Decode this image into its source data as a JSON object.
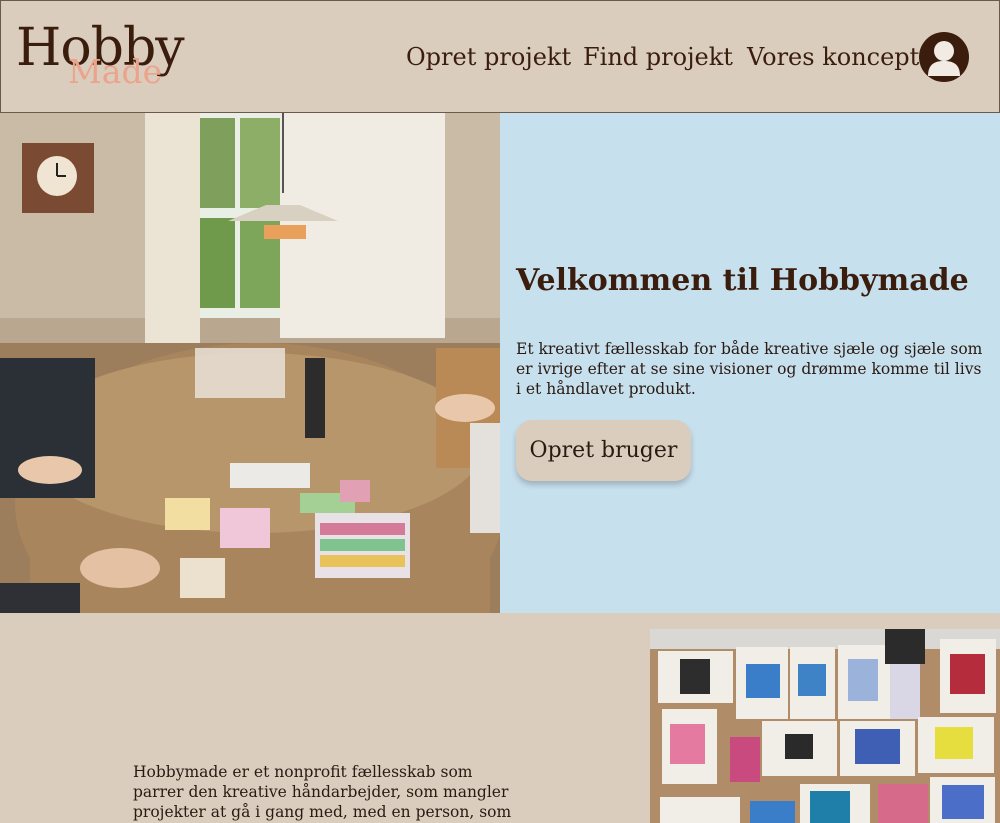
{
  "header": {
    "logo": {
      "line1": "Hobby",
      "line2": "Made"
    },
    "nav": [
      {
        "label": "Opret projekt"
      },
      {
        "label": "Find projekt"
      },
      {
        "label": "Vores koncept"
      }
    ],
    "avatar_icon": "user-avatar-icon"
  },
  "hero": {
    "title": "Velkommen til Hobbymade",
    "text": "Et kreativt fællesskab for både kreative sjæle og sjæle som er ivrige efter at se sine visioner og drømme komme til livs i et håndlavet produkt.",
    "button_label": "Opret bruger",
    "image_icon": "workshop-table-photo"
  },
  "about": {
    "text": "Hobbymade er et nonprofit fællesskab som parrer den kreative håndarbejder, som mangler projekter at gå i gang med, med en person, som har ønsker,"
  },
  "art_image_icon": "art-prints-photo",
  "colors": {
    "background": "#dbcdbd",
    "hero_panel": "#c7e0ee",
    "text_dark": "#3b1d0e",
    "logo_accent": "#eba48c"
  }
}
